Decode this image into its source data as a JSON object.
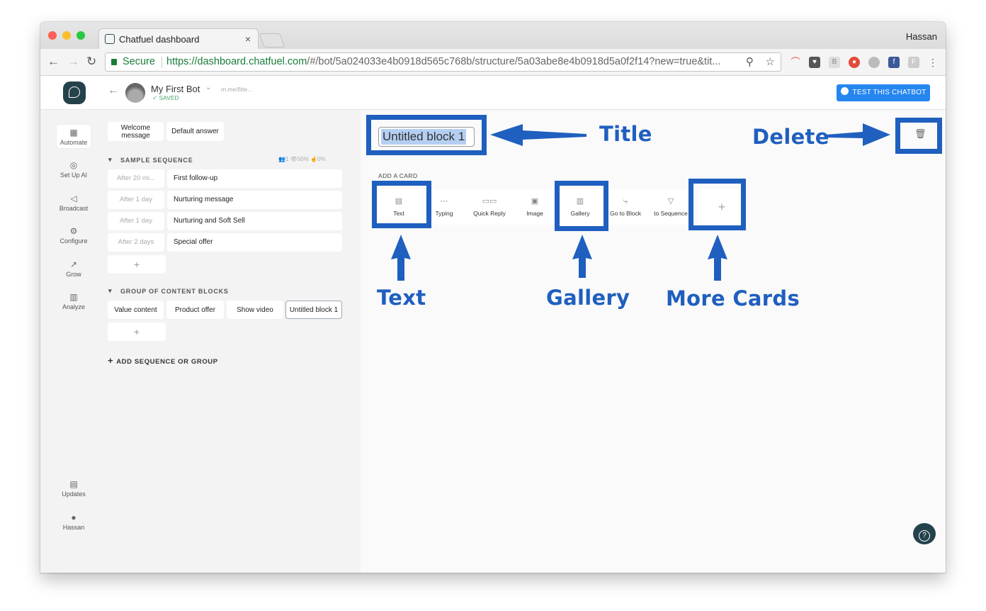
{
  "browser": {
    "tab_title": "Chatfuel dashboard",
    "profile_name": "Hassan",
    "secure_label": "Secure",
    "url_main": "https://dashboard.chatfuel.com",
    "url_rest": "/#/bot/5a024033e4b0918d565c768b/structure/5a03abe8e4b0918d5a0f2f14?new=true&tit..."
  },
  "header": {
    "bot_name": "My First Bot",
    "saved_label": "✓ SAVED",
    "bot_link": "m.me/fitte...",
    "test_button": "TEST THIS CHATBOT"
  },
  "leftnav": {
    "items": [
      {
        "label": "Automate",
        "icon": "automate-icon"
      },
      {
        "label": "Set Up AI",
        "icon": "ai-icon"
      },
      {
        "label": "Broadcast",
        "icon": "broadcast-icon"
      },
      {
        "label": "Configure",
        "icon": "configure-icon"
      },
      {
        "label": "Grow",
        "icon": "grow-icon"
      },
      {
        "label": "Analyze",
        "icon": "analyze-icon"
      }
    ],
    "updates_label": "Updates",
    "user_label": "Hassan"
  },
  "blocks": {
    "welcome": "Welcome message",
    "default_answer": "Default answer",
    "sample_sequence": {
      "title": "SAMPLE SEQUENCE",
      "stat_users": "1",
      "stat_open": "50%",
      "stat_click": "0%",
      "rows": [
        {
          "delay": "After 20 mi...",
          "name": "First follow-up"
        },
        {
          "delay": "After 1 day",
          "name": "Nurturing message"
        },
        {
          "delay": "After 1 day",
          "name": "Nurturing and Soft Sell"
        },
        {
          "delay": "After 2 days",
          "name": "Special offer"
        }
      ]
    },
    "group": {
      "title": "GROUP OF CONTENT BLOCKS",
      "items": [
        "Value content",
        "Product offer",
        "Show video",
        "Untitled block 1"
      ]
    },
    "add_sequence": "ADD SEQUENCE OR GROUP",
    "plus": "+"
  },
  "editor": {
    "block_title": "Untitled block 1",
    "add_card_label": "ADD A CARD",
    "cards": [
      {
        "label": "Text",
        "icon": "text-card-icon"
      },
      {
        "label": "Typing",
        "icon": "typing-card-icon"
      },
      {
        "label": "Quick Reply",
        "icon": "quick-reply-icon"
      },
      {
        "label": "Image",
        "icon": "image-card-icon"
      },
      {
        "label": "Gallery",
        "icon": "gallery-card-icon"
      },
      {
        "label": "Go to Block",
        "icon": "go-to-block-icon"
      },
      {
        "label": "to Sequence",
        "icon": "to-sequence-icon"
      }
    ],
    "more_cards": "+"
  },
  "annotations": {
    "title": "Title",
    "delete": "Delete",
    "text": "Text",
    "gallery": "Gallery",
    "more_cards": "More Cards",
    "color": "#1f5fbf"
  }
}
